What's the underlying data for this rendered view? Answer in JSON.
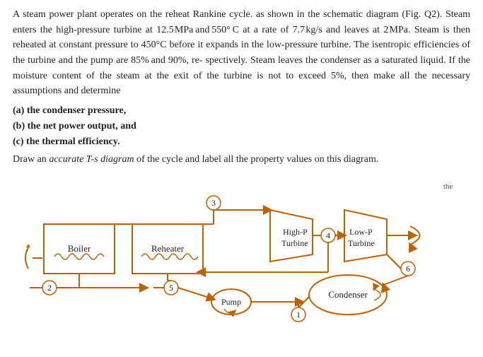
{
  "paragraph1": "A steam power plant operates on the reheat Rankine cycle. as shown in the schematic diagram (Fig. Q2). Steam enters the high-pressure turbine at 12.5 MPa and 550°C at a rate of 7.7 kg/s and leaves at 2 MPa. Steam is then reheated at constant pressure to 450°C before it expands in the low-pressure turbine. The isentropic efficiencies of the turbine and the pump are 85% and 90%, re-spectively. Steam leaves the condenser as a saturated liquid. If the moisture content of the steam at the exit of the turbine is not to exceed 5%, then make all the necessary assumptions and determine",
  "list": [
    "(a) the condenser pressure,",
    "(b) the net power output, and",
    "(c) the thermal efficiency."
  ],
  "paragraph2": "Draw an accurate T-s diagram of the cycle and label all the property values on this diagram.",
  "labels": {
    "boiler": "Boiler",
    "reheater": "Reheater",
    "highP": "High-P",
    "turbine1": "Turbine",
    "lowP": "Low-P",
    "turbine2": "Turbine",
    "pump": "Pump",
    "condenser": "Condenser",
    "node1": "1",
    "node2": "2",
    "node3": "3",
    "node4": "4",
    "node5": "5",
    "node6": "6"
  },
  "accent_color": "#c06000",
  "line_color": "#c06000"
}
